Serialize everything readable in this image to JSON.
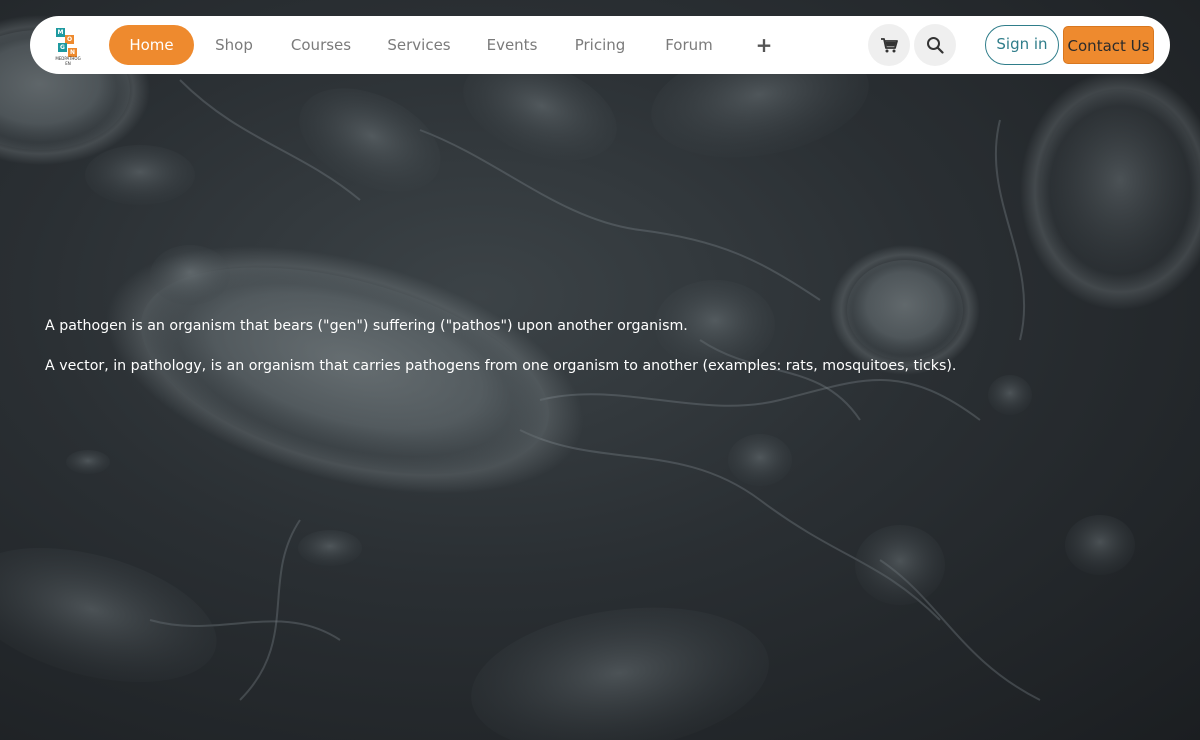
{
  "logo": {
    "letters": [
      "M",
      "O",
      "G",
      "N"
    ],
    "caption_line1": "MEDPATHOG",
    "caption_line2": "EN",
    "colors": [
      "#1e9aa0",
      "#ee8a2e",
      "#1e9aa0",
      "#ee8a2e"
    ]
  },
  "nav": {
    "items": [
      {
        "label": "Home",
        "active": true
      },
      {
        "label": "Shop",
        "active": false
      },
      {
        "label": "Courses",
        "active": false
      },
      {
        "label": "Services",
        "active": false
      },
      {
        "label": "Events",
        "active": false
      },
      {
        "label": "Pricing",
        "active": false
      },
      {
        "label": "Forum",
        "active": false
      }
    ],
    "more_icon": "plus-icon",
    "cart_icon": "cart-icon",
    "search_icon": "search-icon",
    "signin_label": "Sign in",
    "contact_label": "Contact Us"
  },
  "content": {
    "paragraph1": "A pathogen is an organism that bears (\"gen\") suffering (\"pathos\") upon another organism.",
    "paragraph2": "A vector, in pathology, is an organism that carries pathogens from one organism to another (examples: rats, mosquitoes, ticks)."
  },
  "colors": {
    "accent": "#ee8a2e",
    "teal": "#2f7d8a",
    "nav_text": "#7b7b7b"
  }
}
